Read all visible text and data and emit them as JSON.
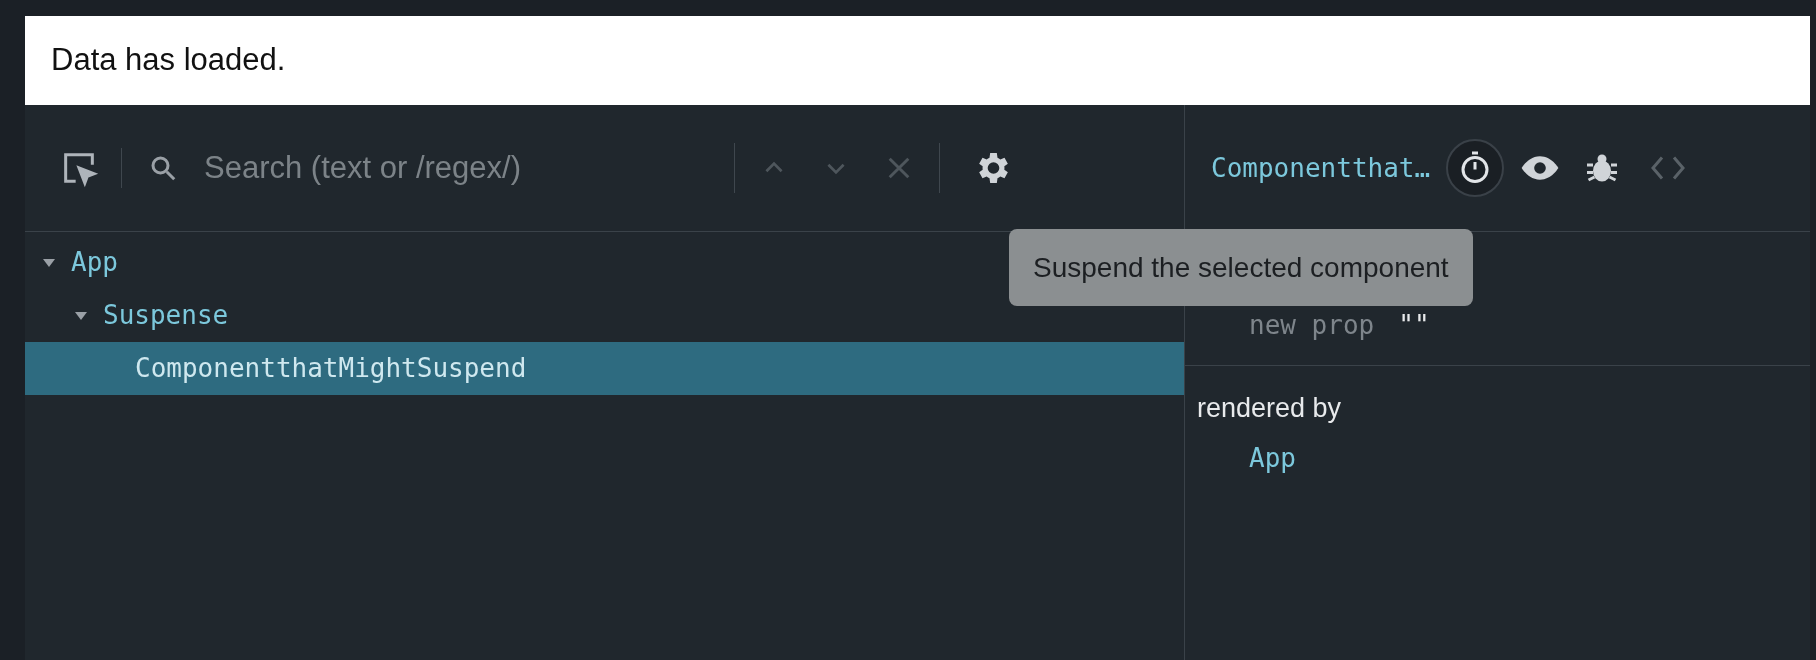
{
  "banner": {
    "text": "Data has loaded."
  },
  "toolbar": {
    "search": {
      "placeholder": "Search (text or /regex/)"
    }
  },
  "tree": [
    {
      "name": "App",
      "expanded": true,
      "selected": false,
      "children": [
        {
          "name": "Suspense",
          "expanded": true,
          "selected": false,
          "children": [
            {
              "name": "ComponentthatMightSuspend",
              "selected": true
            }
          ]
        }
      ]
    }
  ],
  "inspector": {
    "title": "Componentthat…",
    "props": [
      {
        "name": "new prop",
        "value": "\"\""
      }
    ],
    "rendered_by_label": "rendered by",
    "rendered_by": [
      "App"
    ]
  },
  "tooltip": {
    "text": "Suspend the selected component"
  }
}
